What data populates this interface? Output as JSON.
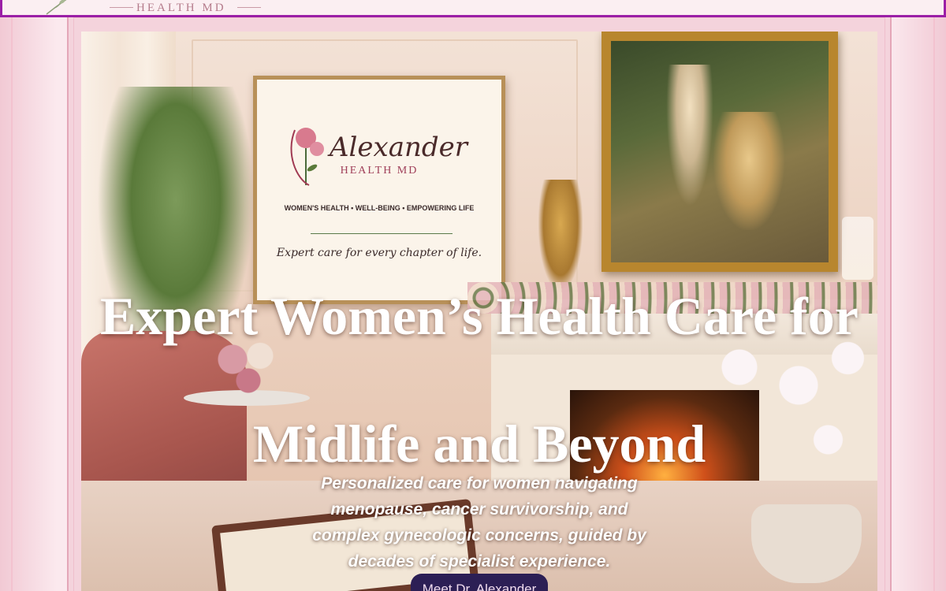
{
  "header": {
    "logo_text": "HEALTH MD"
  },
  "hero_image": {
    "sign_title": "Alexander",
    "sign_subtitle": "HEALTH MD",
    "sign_tagline": "WOMEN'S HEALTH  •  WELL-BEING  •  EMPOWERING LIFE",
    "sign_script": "Expert care for every chapter of life."
  },
  "hero": {
    "title_line1": "Expert Women’s Health Care for",
    "title_line2": "Midlife and Beyond",
    "subtitle": "Personalized care for women navigating menopause, cancer survivorship, and complex gynecologic concerns, guided by decades of specialist experience.",
    "cta_label": "Meet Dr. Alexander"
  },
  "colors": {
    "header_border": "#9b1fa6",
    "cta_background": "#2c1f55",
    "accent_pink": "#e4a6b8"
  },
  "icons": {
    "logo_mark": "sprig-icon"
  }
}
